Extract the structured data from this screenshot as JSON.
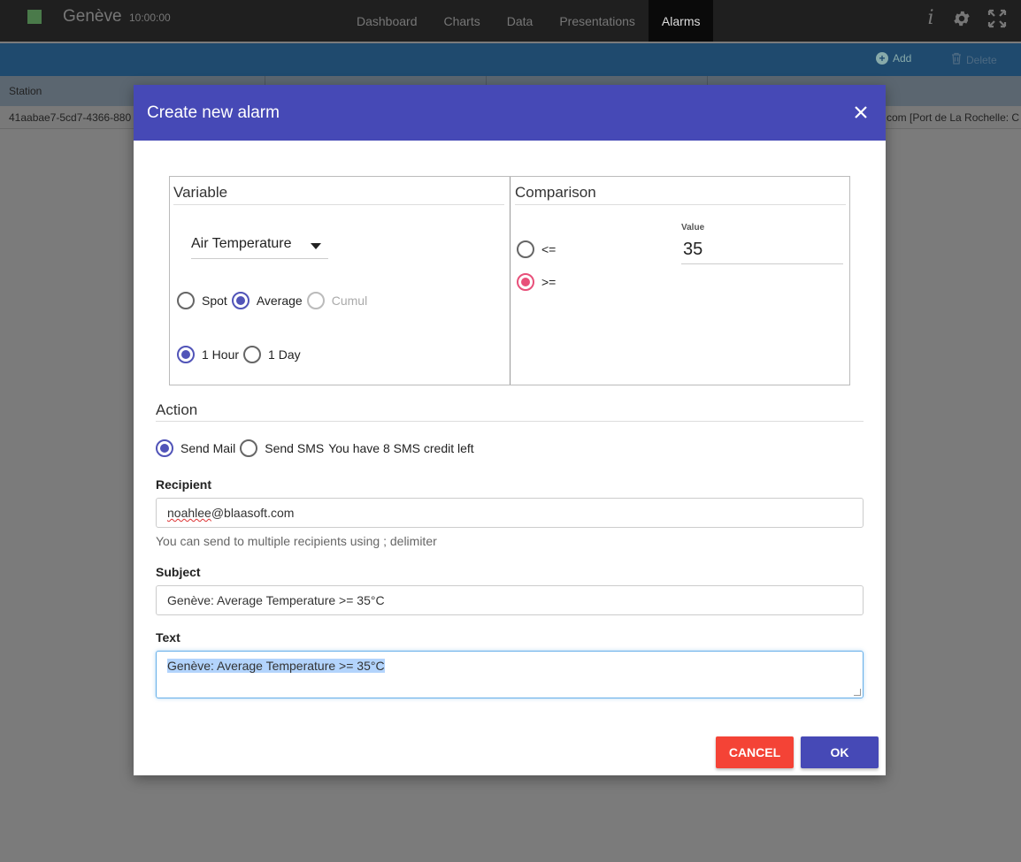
{
  "header": {
    "station": "Genève",
    "time": "10:00:00",
    "status_color": "#4a7a4a",
    "nav": [
      {
        "label": "Dashboard"
      },
      {
        "label": "Charts"
      },
      {
        "label": "Data"
      },
      {
        "label": "Presentations"
      },
      {
        "label": "Alarms"
      }
    ],
    "active_nav": "Alarms",
    "info_label": "i"
  },
  "toolbar": {
    "add_label": "Add",
    "delete_label": "Delete"
  },
  "table": {
    "headers": [
      "Station",
      "",
      "",
      ""
    ],
    "row": {
      "station": "41aabae7-5cd7-4366-880",
      "tail": "com [Port de La Rochelle: C"
    }
  },
  "modal": {
    "title": "Create new alarm",
    "variable": {
      "title": "Variable",
      "selected": "Air Temperature",
      "modes": [
        {
          "label": "Spot",
          "checked": false,
          "disabled": false
        },
        {
          "label": "Average",
          "checked": true,
          "disabled": false
        },
        {
          "label": "Cumul",
          "checked": false,
          "disabled": true
        }
      ],
      "periods": [
        {
          "label": "1 Hour",
          "checked": true
        },
        {
          "label": "1 Day",
          "checked": false
        }
      ]
    },
    "comparison": {
      "title": "Comparison",
      "value_label": "Value",
      "value": "35",
      "operators": [
        {
          "label": "<=",
          "checked": false
        },
        {
          "label": ">=",
          "checked": true
        }
      ]
    },
    "action": {
      "title": "Action",
      "send_mail": "Send Mail",
      "send_sms": "Send SMS",
      "sms_credit": "You have 8 SMS credit left",
      "mail_checked": true
    },
    "recipient": {
      "label": "Recipient",
      "value_part1": "noahlee",
      "value_part2": "@blaasoft.com",
      "help": "You can send to multiple recipients using ; delimiter"
    },
    "subject": {
      "label": "Subject",
      "value": "Genève: Average Temperature >= 35°C"
    },
    "text": {
      "label": "Text",
      "value": "Genève: Average Temperature >= 35°C"
    },
    "buttons": {
      "cancel": "CANCEL",
      "ok": "OK"
    },
    "colors": {
      "primary": "#4649b6",
      "danger": "#f44336",
      "accent": "#e8507a"
    }
  }
}
